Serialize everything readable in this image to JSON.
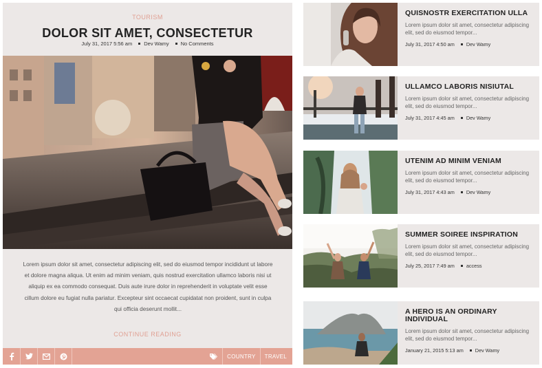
{
  "featured": {
    "category": "TOURISM",
    "title": "DOLOR SIT AMET, CONSECTETUR",
    "date": "July 31, 2017 5:56 am",
    "author": "Dev Wamy",
    "comments": "No Comments",
    "excerpt": "Lorem ipsum dolor sit amet, consectetur adipiscing elit, sed do eiusmod tempor incididunt ut labore et dolore magna aliqua. Ut enim ad minim veniam, quis nostrud exercitation ullamco laboris nisi ut aliquip ex ea commodo consequat. Duis aute irure dolor in reprehenderit in voluptate velit esse cillum dolore eu fugiat nulla pariatur. Excepteur sint occaecat cupidatat non proident, sunt in culpa qui officia deserunt mollit...",
    "read_more": "CONTINUE READING",
    "social_icons": [
      "facebook-icon",
      "twitter-icon",
      "email-icon",
      "pinterest-icon"
    ],
    "tag_icon": "tag-icon",
    "tags": [
      "COUNTRY",
      "TRAVEL"
    ]
  },
  "side_posts": [
    {
      "title": "QUISNOSTR EXERCITATION ULLA",
      "excerpt": "Lorem ipsum dolor sit amet, consectetur adipiscing elit, sed do eiusmod tempor...",
      "date": "July 31, 2017 4:50 am",
      "author": "Dev Wamy"
    },
    {
      "title": "ULLAMCO LABORIS NISIUTAL",
      "excerpt": "Lorem ipsum dolor sit amet, consectetur adipiscing elit, sed do eiusmod tempor...",
      "date": "July 31, 2017 4:45 am",
      "author": "Dev Wamy"
    },
    {
      "title": "UTENIM AD MINIM VENIAM",
      "excerpt": "Lorem ipsum dolor sit amet, consectetur adipiscing elit, sed do eiusmod tempor...",
      "date": "July 31, 2017 4:43 am",
      "author": "Dev Wamy"
    },
    {
      "title": "SUMMER SOIREE INSPIRATION",
      "excerpt": "Lorem ipsum dolor sit amet, consectetur adipiscing elit, sed do eiusmod tempor...",
      "date": "July 25, 2017 7:49 am",
      "author": "access"
    },
    {
      "title": "A HERO IS AN ORDINARY INDIVIDUAL",
      "excerpt": "Lorem ipsum dolor sit amet, consectetur adipiscing elit, sed do eiusmod tempor...",
      "date": "January 21, 2015 5:13 am",
      "author": "Dev Wamy"
    }
  ],
  "colors": {
    "accent": "#e3a394",
    "card_background": "#ece8e7",
    "title_text": "#222222"
  }
}
